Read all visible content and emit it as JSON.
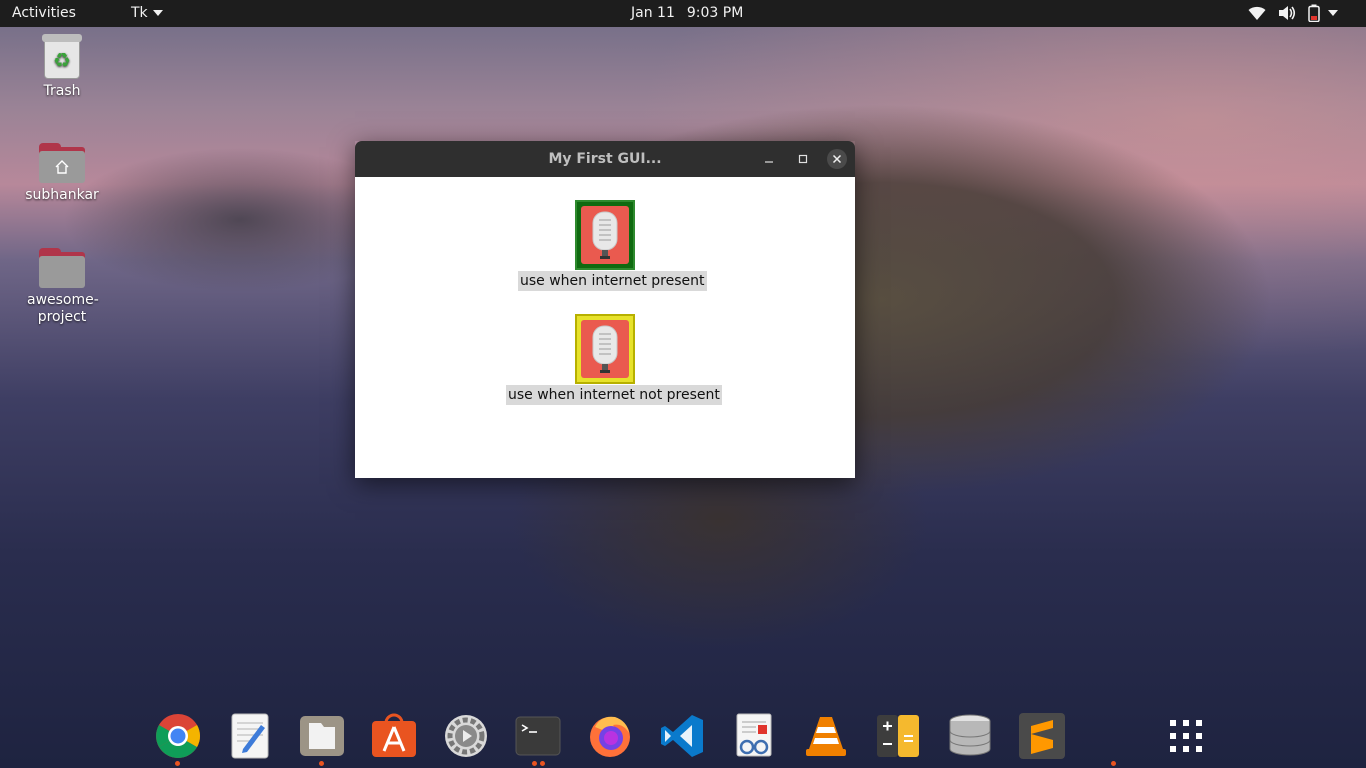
{
  "topbar": {
    "activities": "Activities",
    "app_menu": "Tk",
    "date": "Jan 11",
    "time": "9:03 PM"
  },
  "desktop": {
    "icons": [
      {
        "label": "Trash",
        "icon": "trash-icon"
      },
      {
        "label": "subhankar",
        "icon": "home-folder-icon"
      },
      {
        "label": "awesome-project",
        "icon": "folder-icon"
      }
    ]
  },
  "window": {
    "title": "My First GUI...",
    "buttons": [
      {
        "label": "use when internet present",
        "color": "#0f6a10",
        "icon": "microphone-icon"
      },
      {
        "label": "use when internet not present",
        "color": "#e7e22a",
        "icon": "microphone-icon"
      }
    ]
  },
  "dock": {
    "apps": [
      {
        "name": "Google Chrome",
        "icon": "chrome-icon",
        "running": true
      },
      {
        "name": "Text Editor",
        "icon": "text-editor-icon",
        "running": false
      },
      {
        "name": "Files",
        "icon": "files-icon",
        "running": true
      },
      {
        "name": "Ubuntu Software",
        "icon": "software-center-icon",
        "running": false
      },
      {
        "name": "Settings",
        "icon": "settings-icon",
        "running": false
      },
      {
        "name": "Terminal",
        "icon": "terminal-icon",
        "running": true
      },
      {
        "name": "Firefox",
        "icon": "firefox-icon",
        "running": false
      },
      {
        "name": "Visual Studio Code",
        "icon": "vscode-icon",
        "running": false
      },
      {
        "name": "Document Viewer",
        "icon": "document-viewer-icon",
        "running": false
      },
      {
        "name": "VLC",
        "icon": "vlc-icon",
        "running": false
      },
      {
        "name": "Calculator",
        "icon": "calculator-icon",
        "running": false
      },
      {
        "name": "Database",
        "icon": "database-icon",
        "running": false
      },
      {
        "name": "Sublime Text",
        "icon": "sublime-text-icon",
        "running": false
      },
      {
        "name": "Show Applications",
        "icon": "app-grid-icon",
        "running": false
      }
    ]
  },
  "colors": {
    "accent": "#e95420",
    "topbar": "#1d1d1d",
    "titlebar": "#2f2f2f"
  }
}
